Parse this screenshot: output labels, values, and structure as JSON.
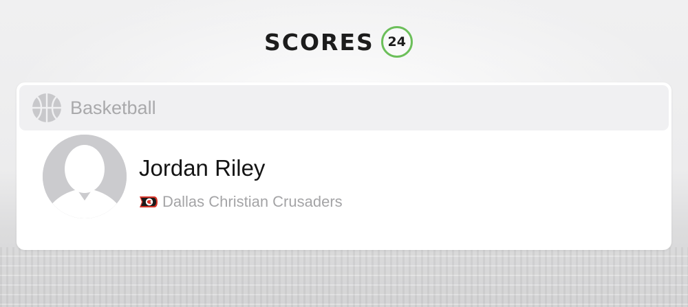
{
  "header": {
    "logo_word": "SCORES",
    "logo_number": "24",
    "badge_color": "#6cbf5a"
  },
  "sport": {
    "label": "Basketball",
    "icon": "basketball-icon"
  },
  "player": {
    "name": "Jordan Riley",
    "avatar_icon": "avatar-placeholder-icon",
    "team": {
      "name": "Dallas Christian Crusaders",
      "logo_icon": "team-crest-icon",
      "logo_color": "#d8352a"
    }
  }
}
